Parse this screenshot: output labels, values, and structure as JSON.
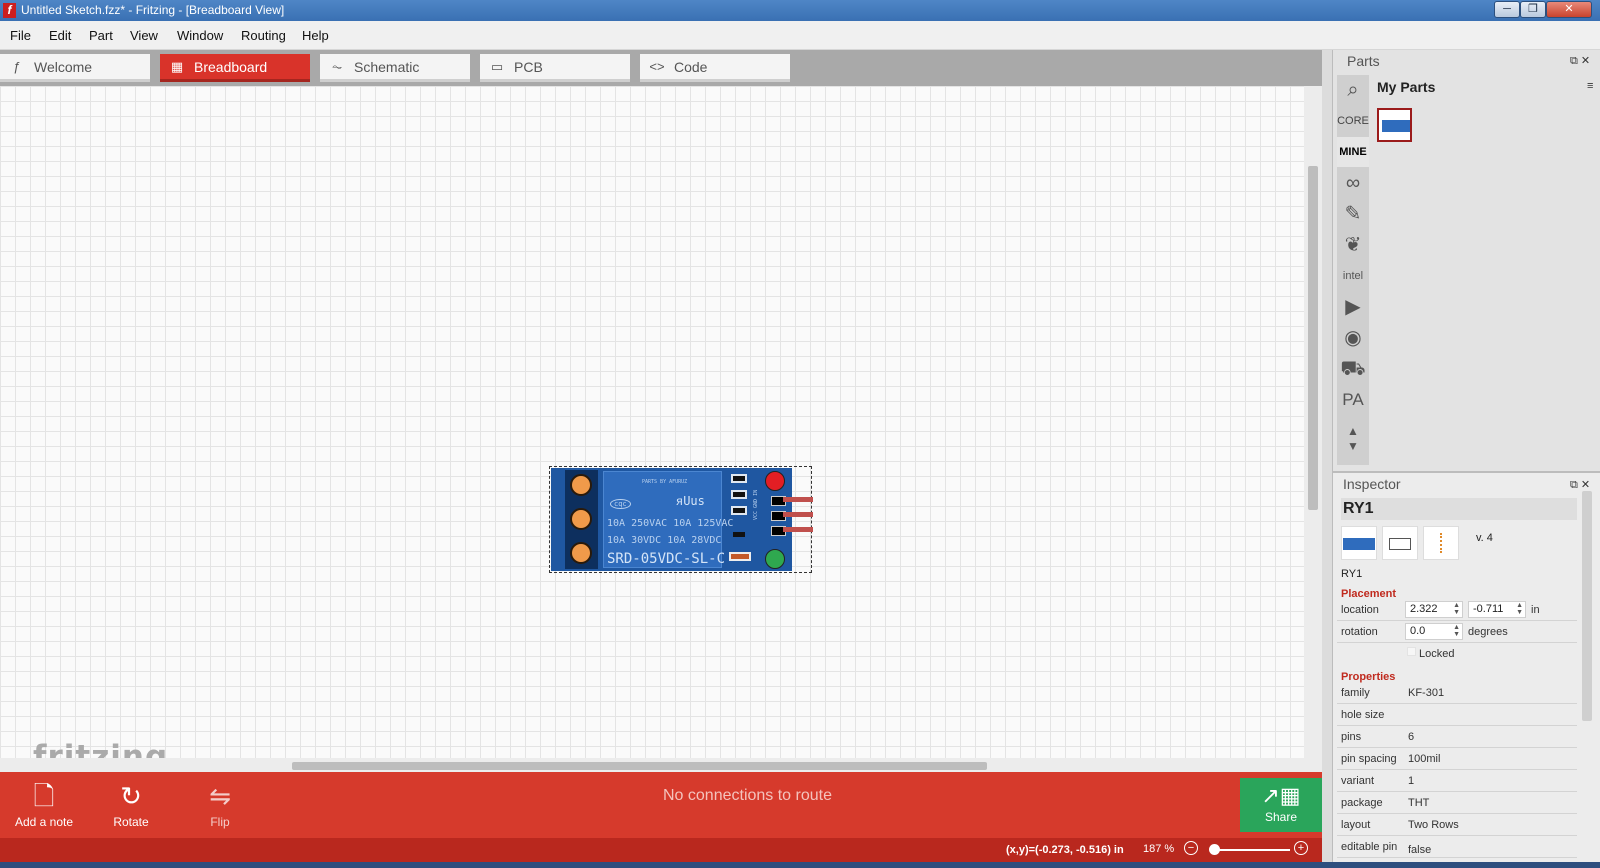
{
  "window": {
    "title": "Untitled Sketch.fzz* - Fritzing - [Breadboard View]",
    "app_icon": "f"
  },
  "menu": [
    "File",
    "Edit",
    "Part",
    "View",
    "Window",
    "Routing",
    "Help"
  ],
  "tabs": [
    {
      "label": "Welcome",
      "icon": "fritzing-f-icon"
    },
    {
      "label": "Breadboard",
      "icon": "breadboard-icon",
      "active": true
    },
    {
      "label": "Schematic",
      "icon": "resistor-icon"
    },
    {
      "label": "PCB",
      "icon": "pcb-icon"
    },
    {
      "label": "Code",
      "icon": "code-icon"
    }
  ],
  "canvas": {
    "watermark": "fritzing",
    "relay": {
      "brand": "PARTS BY AFURUZ",
      "line1": "10A 250VAC  10A 125VAC",
      "line2": "10A  30VDC  10A  28VDC",
      "model": "SRD-05VDC-SL-C",
      "cert": "cqc",
      "ul": "ᴙUus",
      "pin_labels": "VCC GND IN"
    }
  },
  "toolbar": {
    "add_note": "Add a note",
    "rotate": "Rotate",
    "flip": "Flip",
    "status": "No connections to route",
    "share": "Share"
  },
  "statusbar": {
    "coords": "(x,y)=(-0.273, -0.516) in",
    "zoom": "187 %"
  },
  "parts_panel": {
    "title": "Parts",
    "bins": [
      "CORE",
      "MINE"
    ],
    "bin_title": "My Parts"
  },
  "inspector": {
    "title": "Inspector",
    "part_name": "RY1",
    "version": "v. 4",
    "label": "RY1",
    "placement_title": "Placement",
    "location_label": "location",
    "location_x": "2.322",
    "location_y": "-0.711",
    "location_unit": "in",
    "rotation_label": "rotation",
    "rotation_value": "0.0",
    "rotation_unit": "degrees",
    "locked_label": "Locked",
    "properties_title": "Properties",
    "properties": [
      {
        "key": "family",
        "value": "KF-301"
      },
      {
        "key": "hole size",
        "value": ""
      },
      {
        "key": "pins",
        "value": "6"
      },
      {
        "key": "pin spacing",
        "value": "100mil"
      },
      {
        "key": "variant",
        "value": "1"
      },
      {
        "key": "package",
        "value": "THT"
      },
      {
        "key": "layout",
        "value": "Two Rows"
      },
      {
        "key": "editable pin",
        "value": "false"
      }
    ]
  },
  "colors": {
    "accent": "#d63a2c",
    "share": "#2aa55b",
    "relay_blue": "#1f57a1"
  }
}
